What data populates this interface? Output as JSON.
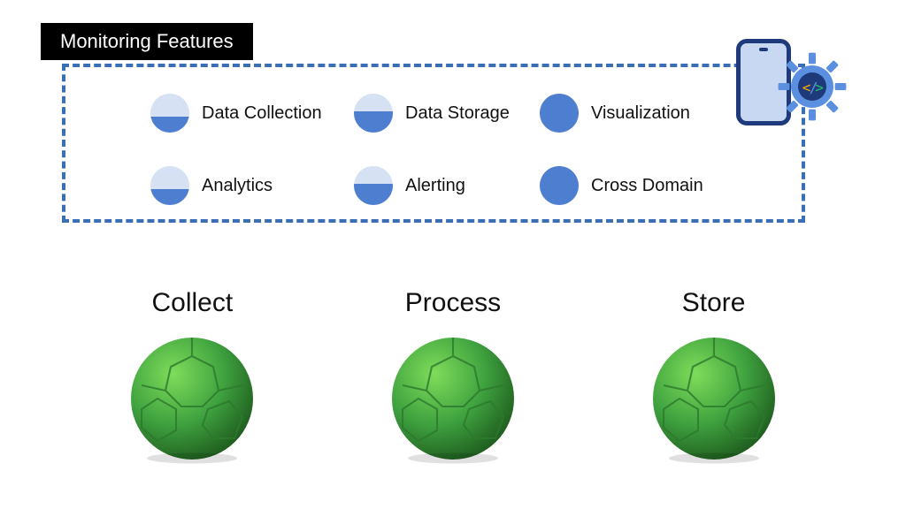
{
  "title": "Monitoring Features",
  "features": {
    "row1": [
      {
        "label": "Data Collection",
        "fill_pct": 40
      },
      {
        "label": "Data Storage",
        "fill_pct": 55
      },
      {
        "label": "Visualization",
        "fill_pct": 100
      }
    ],
    "row2": [
      {
        "label": "Analytics",
        "fill_pct": 40
      },
      {
        "label": "Alerting",
        "fill_pct": 55
      },
      {
        "label": "Cross Domain",
        "fill_pct": 100
      }
    ]
  },
  "stages": [
    {
      "label": "Collect"
    },
    {
      "label": "Process"
    },
    {
      "label": "Store"
    }
  ],
  "colors": {
    "dashed_border": "#3b6fb5",
    "coin_bg": "#d7e1f4",
    "coin_fill": "#4e7ecf",
    "sphere_green": "#3fa23f",
    "phone_border": "#1e3a7a"
  }
}
